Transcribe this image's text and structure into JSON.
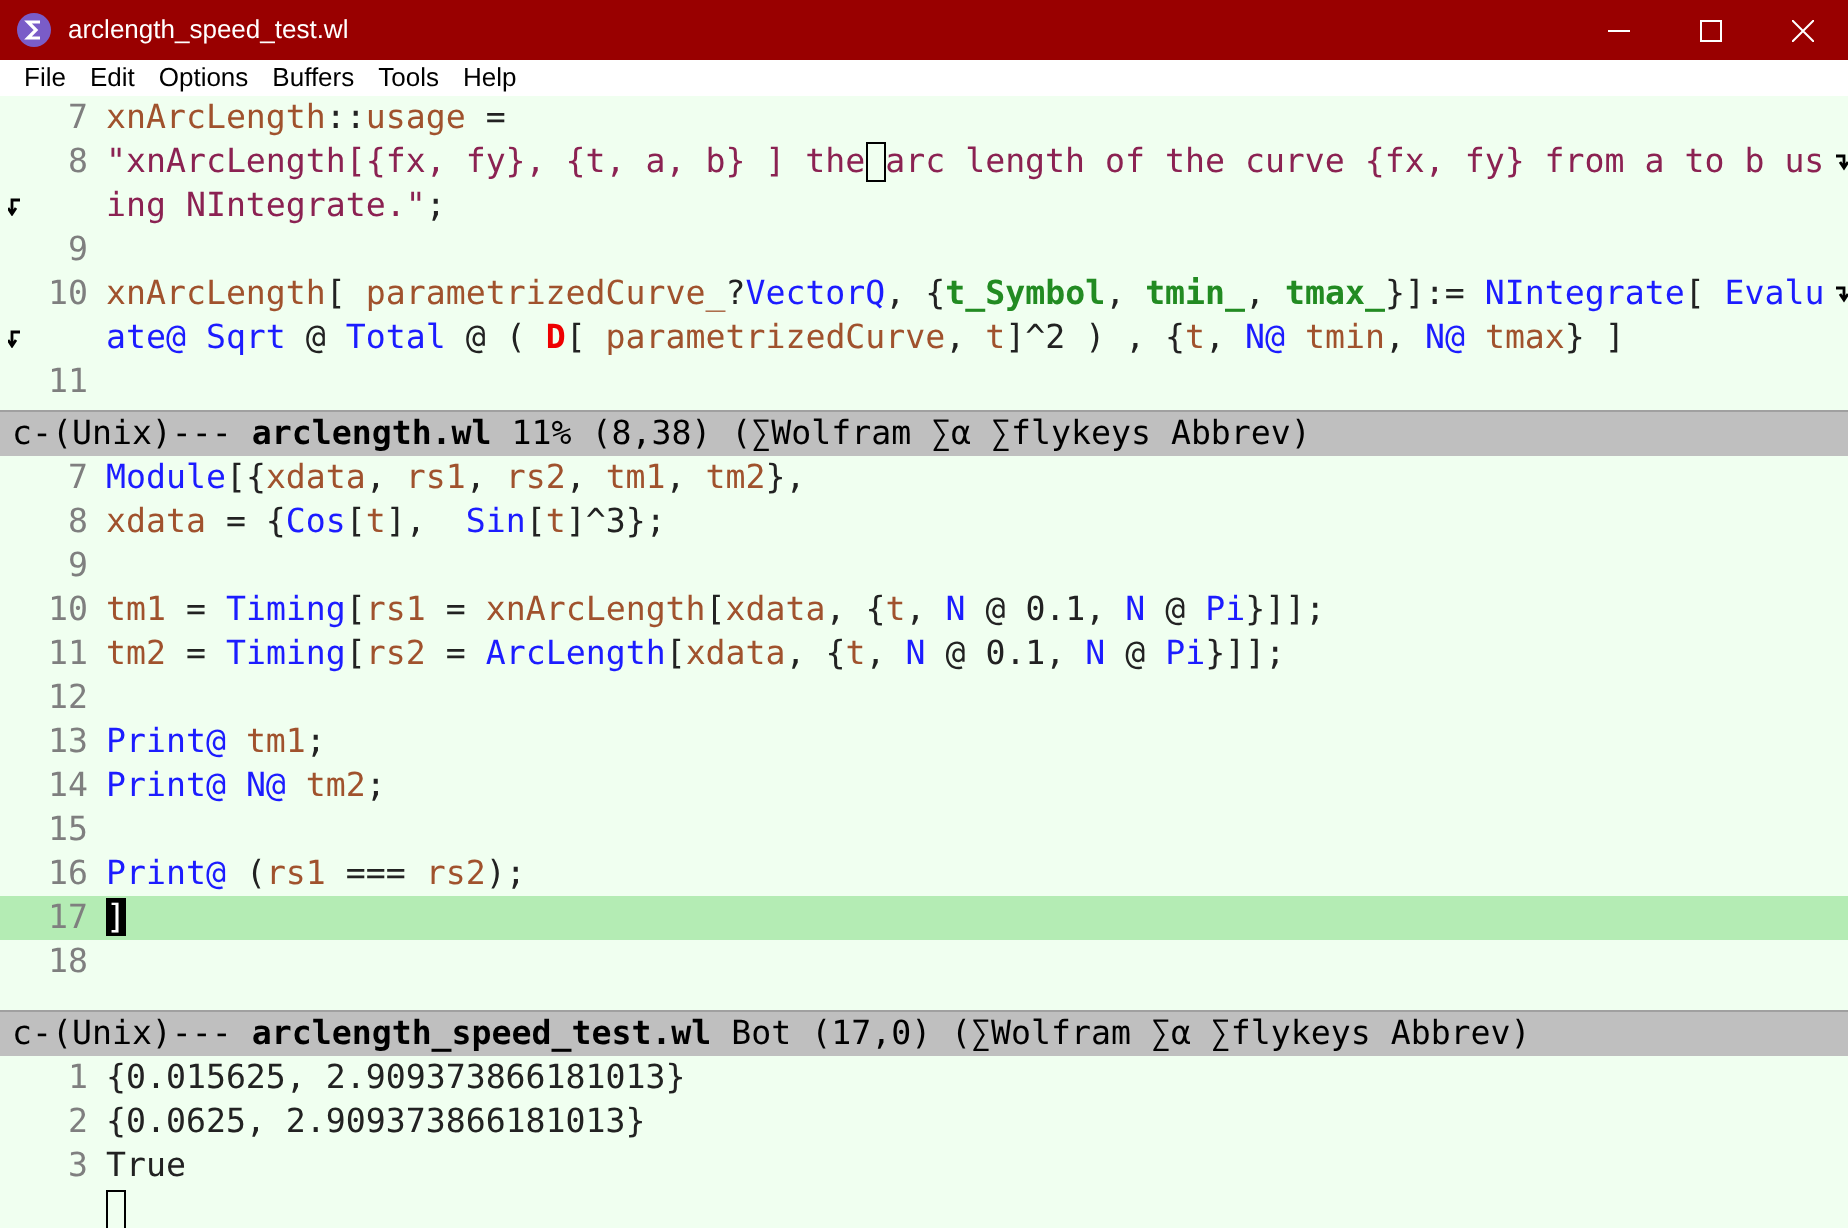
{
  "window": {
    "title": "arclength_speed_test.wl"
  },
  "menu": [
    "File",
    "Edit",
    "Options",
    "Buffers",
    "Tools",
    "Help"
  ],
  "panes": [
    {
      "lines": [
        {
          "number": "7",
          "current": false,
          "parts": [
            [
              {
                "kind": "var",
                "text": "xnArcLength"
              },
              {
                "kind": "plain",
                "text": "::"
              },
              {
                "kind": "var",
                "text": "usage"
              },
              {
                "kind": "plain",
                "text": " ="
              }
            ]
          ]
        },
        {
          "number": "8",
          "current": false,
          "parts": [
            [
              {
                "kind": "string",
                "text": "\"xnArcLength[{fx, fy}, {t, a, b} ] the"
              },
              {
                "kind": "cursor"
              },
              {
                "kind": "string",
                "text": "arc length of the curve {fx, fy} from a to b us"
              }
            ],
            [
              {
                "kind": "string",
                "text": "ing NIntegrate.\""
              },
              {
                "kind": "plain",
                "text": ";"
              }
            ]
          ]
        },
        {
          "number": "9",
          "current": false
        },
        {
          "number": "10",
          "current": false,
          "parts": [
            [
              {
                "kind": "var",
                "text": "xnArcLength"
              },
              {
                "kind": "plain",
                "text": "[ "
              },
              {
                "kind": "var",
                "text": "parametrizedCurve_"
              },
              {
                "kind": "plain",
                "text": "?"
              },
              {
                "kind": "builtin",
                "text": "VectorQ"
              },
              {
                "kind": "plain",
                "text": ", {"
              },
              {
                "kind": "pattern",
                "text": "t_Symbol"
              },
              {
                "kind": "plain",
                "text": ", "
              },
              {
                "kind": "pattern",
                "text": "tmin_"
              },
              {
                "kind": "plain",
                "text": ", "
              },
              {
                "kind": "pattern",
                "text": "tmax_"
              },
              {
                "kind": "plain",
                "text": "}]:= "
              },
              {
                "kind": "builtin",
                "text": "NIntegrate"
              },
              {
                "kind": "plain",
                "text": "[ "
              },
              {
                "kind": "builtin",
                "text": "Evalu"
              }
            ],
            [
              {
                "kind": "builtin",
                "text": "ate@ "
              },
              {
                "kind": "builtin",
                "text": "Sqrt"
              },
              {
                "kind": "plain",
                "text": " @ "
              },
              {
                "kind": "builtin",
                "text": "Total"
              },
              {
                "kind": "plain",
                "text": " @ ( "
              },
              {
                "kind": "error",
                "text": "D"
              },
              {
                "kind": "plain",
                "text": "[ "
              },
              {
                "kind": "var",
                "text": "parametrizedCurve"
              },
              {
                "kind": "plain",
                "text": ", "
              },
              {
                "kind": "var",
                "text": "t"
              },
              {
                "kind": "plain",
                "text": "]^2 ) , {"
              },
              {
                "kind": "var",
                "text": "t"
              },
              {
                "kind": "plain",
                "text": ", "
              },
              {
                "kind": "builtin",
                "text": "N@ "
              },
              {
                "kind": "var",
                "text": "tmin"
              },
              {
                "kind": "plain",
                "text": ", "
              },
              {
                "kind": "builtin",
                "text": "N@ "
              },
              {
                "kind": "var",
                "text": "tmax"
              },
              {
                "kind": "plain",
                "text": "} ]"
              }
            ]
          ]
        },
        {
          "number": "11",
          "current": false
        }
      ],
      "mode_line": "c-(Unix)--- **arclength.wl** 11% (8,38) (∑Wolfram ∑α ∑flykeys Abbrev)"
    },
    {
      "lines": [
        {
          "number": "7",
          "current": false,
          "parts": [
            [
              {
                "kind": "builtin",
                "text": "Module"
              },
              {
                "kind": "plain",
                "text": "[{"
              },
              {
                "kind": "var",
                "text": "xdata"
              },
              {
                "kind": "plain",
                "text": ", "
              },
              {
                "kind": "var",
                "text": "rs1"
              },
              {
                "kind": "plain",
                "text": ", "
              },
              {
                "kind": "var",
                "text": "rs2"
              },
              {
                "kind": "plain",
                "text": ", "
              },
              {
                "kind": "var",
                "text": "tm1"
              },
              {
                "kind": "plain",
                "text": ", "
              },
              {
                "kind": "var",
                "text": "tm2"
              },
              {
                "kind": "plain",
                "text": "},"
              }
            ]
          ]
        },
        {
          "number": "8",
          "current": false,
          "parts": [
            [
              {
                "kind": "var",
                "text": "xdata"
              },
              {
                "kind": "plain",
                "text": " = {"
              },
              {
                "kind": "builtin",
                "text": "Cos"
              },
              {
                "kind": "plain",
                "text": "["
              },
              {
                "kind": "var",
                "text": "t"
              },
              {
                "kind": "plain",
                "text": "],  "
              },
              {
                "kind": "builtin",
                "text": "Sin"
              },
              {
                "kind": "plain",
                "text": "["
              },
              {
                "kind": "var",
                "text": "t"
              },
              {
                "kind": "plain",
                "text": "]^3};"
              }
            ]
          ]
        },
        {
          "number": "9",
          "current": false
        },
        {
          "number": "10",
          "current": false,
          "parts": [
            [
              {
                "kind": "var",
                "text": "tm1"
              },
              {
                "kind": "plain",
                "text": " = "
              },
              {
                "kind": "builtin",
                "text": "Timing"
              },
              {
                "kind": "plain",
                "text": "["
              },
              {
                "kind": "var",
                "text": "rs1"
              },
              {
                "kind": "plain",
                "text": " = "
              },
              {
                "kind": "var",
                "text": "xnArcLength"
              },
              {
                "kind": "plain",
                "text": "["
              },
              {
                "kind": "var",
                "text": "xdata"
              },
              {
                "kind": "plain",
                "text": ", {"
              },
              {
                "kind": "var",
                "text": "t"
              },
              {
                "kind": "plain",
                "text": ", "
              },
              {
                "kind": "builtin",
                "text": "N"
              },
              {
                "kind": "plain",
                "text": " @ 0.1, "
              },
              {
                "kind": "builtin",
                "text": "N"
              },
              {
                "kind": "plain",
                "text": " @ "
              },
              {
                "kind": "builtin",
                "text": "Pi"
              },
              {
                "kind": "plain",
                "text": "}]];"
              }
            ]
          ]
        },
        {
          "number": "11",
          "current": false,
          "parts": [
            [
              {
                "kind": "var",
                "text": "tm2"
              },
              {
                "kind": "plain",
                "text": " = "
              },
              {
                "kind": "builtin",
                "text": "Timing"
              },
              {
                "kind": "plain",
                "text": "["
              },
              {
                "kind": "var",
                "text": "rs2"
              },
              {
                "kind": "plain",
                "text": " = "
              },
              {
                "kind": "builtin",
                "text": "ArcLength"
              },
              {
                "kind": "plain",
                "text": "["
              },
              {
                "kind": "var",
                "text": "xdata"
              },
              {
                "kind": "plain",
                "text": ", {"
              },
              {
                "kind": "var",
                "text": "t"
              },
              {
                "kind": "plain",
                "text": ", "
              },
              {
                "kind": "builtin",
                "text": "N"
              },
              {
                "kind": "plain",
                "text": " @ 0.1, "
              },
              {
                "kind": "builtin",
                "text": "N"
              },
              {
                "kind": "plain",
                "text": " @ "
              },
              {
                "kind": "builtin",
                "text": "Pi"
              },
              {
                "kind": "plain",
                "text": "}]];"
              }
            ]
          ]
        },
        {
          "number": "12",
          "current": false
        },
        {
          "number": "13",
          "current": false,
          "parts": [
            [
              {
                "kind": "builtin",
                "text": "Print@ "
              },
              {
                "kind": "var",
                "text": "tm1"
              },
              {
                "kind": "plain",
                "text": ";"
              }
            ]
          ]
        },
        {
          "number": "14",
          "current": false,
          "parts": [
            [
              {
                "kind": "builtin",
                "text": "Print@ "
              },
              {
                "kind": "builtin",
                "text": "N@ "
              },
              {
                "kind": "var",
                "text": "tm2"
              },
              {
                "kind": "plain",
                "text": ";"
              }
            ]
          ]
        },
        {
          "number": "15",
          "current": false
        },
        {
          "number": "16",
          "current": false,
          "parts": [
            [
              {
                "kind": "builtin",
                "text": "Print@"
              },
              {
                "kind": "plain",
                "text": " ("
              },
              {
                "kind": "var",
                "text": "rs1"
              },
              {
                "kind": "plain",
                "text": " === "
              },
              {
                "kind": "var",
                "text": "rs2"
              },
              {
                "kind": "plain",
                "text": ");"
              }
            ]
          ]
        },
        {
          "number": "17",
          "current": true,
          "parts": [
            [
              {
                "kind": "cursor_block",
                "text": "]"
              }
            ]
          ]
        },
        {
          "number": "18",
          "current": false
        }
      ],
      "mode_line": "c-(Unix)--- **arclength_speed_test.wl** Bot (17,0) (∑Wolfram ∑α ∑flykeys Abbrev)"
    },
    {
      "lines": [
        {
          "number": "1",
          "current": false,
          "parts": [
            [
              {
                "kind": "plain",
                "text": "{0.015625, 2.909373866181013}"
              }
            ]
          ]
        },
        {
          "number": "2",
          "current": false,
          "parts": [
            [
              {
                "kind": "plain",
                "text": "{0.0625, 2.909373866181013}"
              }
            ]
          ]
        },
        {
          "number": "3",
          "current": false,
          "parts": [
            [
              {
                "kind": "plain",
                "text": "True"
              }
            ]
          ]
        },
        {
          "current": false,
          "parts": [
            [
              {
                "kind": "cursor"
              }
            ]
          ]
        }
      ]
    }
  ]
}
